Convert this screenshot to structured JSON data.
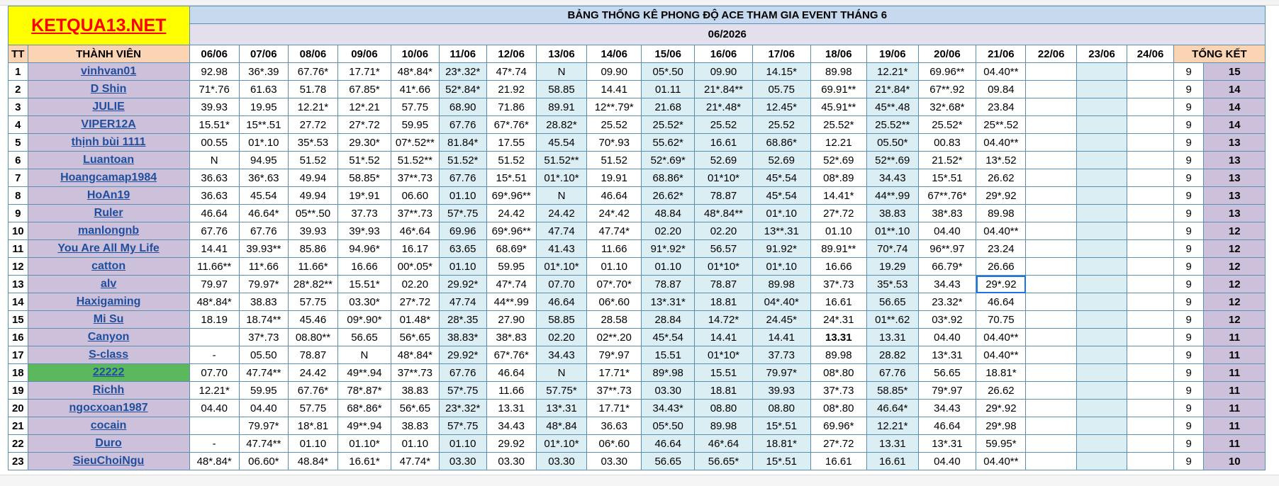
{
  "logo": "KETQUA13.NET",
  "title": "BẢNG THỐNG KÊ PHONG ĐỘ ACE THAM GIA EVENT THÁNG 6",
  "month": "06/2026",
  "headers": {
    "tt": "TT",
    "member": "THÀNH VIÊN",
    "summary": "TỔNG KẾT",
    "dates": [
      "06/06",
      "07/06",
      "08/06",
      "09/06",
      "10/06",
      "11/06",
      "12/06",
      "13/06",
      "14/06",
      "15/06",
      "16/06",
      "17/06",
      "18/06",
      "19/06",
      "20/06",
      "21/06",
      "22/06",
      "23/06",
      "24/06"
    ]
  },
  "colors": {
    "red": "#ff0000",
    "link": "#1f4e9e",
    "header_blue": "#2e75b6",
    "orange": "#ed7d31"
  },
  "rows": [
    {
      "no": "1",
      "name": "vinhvan01",
      "vals": [
        "92.98",
        "36*.39",
        "67.76*",
        "17.71*",
        "48*.84*",
        "23*.32*",
        "47*.74",
        "N",
        "09.90",
        "05*.50",
        "09.90",
        "14.15*",
        "89.98",
        "12.21*",
        "69.96**",
        "04.40**"
      ],
      "cnt": "9",
      "total": "15"
    },
    {
      "no": "2",
      "name": "D Shin",
      "vals": [
        "71*.76",
        "61.63",
        "51.78",
        "67.85*",
        "41*.66",
        "52*.84*",
        "21.92",
        "58.85",
        "14.41",
        "01.11",
        "21*.84**",
        "05.75",
        "69.91**",
        "21*.84*",
        "67**.92",
        "09.84"
      ],
      "cnt": "9",
      "total": "14"
    },
    {
      "no": "3",
      "name": "JULIE",
      "vals": [
        "39.93",
        "19.95",
        "12.21*",
        "12*.21",
        "57.75",
        "68.90",
        "71.86",
        "89.91",
        "12**.79*",
        "21.68",
        "21*.48*",
        "12.45*",
        "45.91**",
        "45**.48",
        "32*.68*",
        "23.84"
      ],
      "cnt": "9",
      "total": "14"
    },
    {
      "no": "4",
      "name": "VIPER12A",
      "vals": [
        "15.51*",
        "15**.51",
        "27.72",
        "27*.72",
        "59.95",
        "67.76",
        "67*.76*",
        "28.82*",
        "25.52",
        "25.52*",
        "25.52",
        "25.52",
        "25.52*",
        "25.52**",
        "25.52*",
        "25**.52"
      ],
      "cnt": "9",
      "total": "14"
    },
    {
      "no": "5",
      "name": "thịnh bùi 1111",
      "vals": [
        "00.55",
        "01*.10",
        "35*.53",
        "29.30*",
        "07*.52**",
        "81.84*",
        "17.55",
        "45.54",
        "70*.93",
        "55.62*",
        "16.61",
        "68.86*",
        "12.21",
        "05.50*",
        "00.83",
        "04.40**"
      ],
      "cnt": "9",
      "total": "13"
    },
    {
      "no": "6",
      "name": "Luantoan",
      "vals": [
        "N",
        "94.95",
        "51.52",
        "51*.52",
        "51.52**",
        "51.52*",
        "51.52",
        "51.52**",
        "51.52",
        "52*.69*",
        "52.69",
        "52.69",
        "52*.69",
        "52**.69",
        "21.52*",
        "13*.52"
      ],
      "cnt": "9",
      "total": "13"
    },
    {
      "no": "7",
      "name": "Hoangcamap1984",
      "vals": [
        "36.63",
        "36*.63",
        "49.94",
        "58.85*",
        "37**.73",
        "67.76",
        "15*.51",
        "01*.10*",
        "19.91",
        "68.86*",
        "01*10*",
        "45*.54",
        "08*.89",
        "34.43",
        "15*.51",
        "26.62"
      ],
      "cnt": "9",
      "total": "13"
    },
    {
      "no": "8",
      "name": "HoAn19",
      "vals": [
        "36.63",
        "45.54",
        "49.94",
        "19*.91",
        "06.60",
        "01.10",
        "69*.96**",
        "N",
        "46.64",
        "26.62*",
        "78.87",
        "45*.54",
        "14.41*",
        "44**.99",
        "67**.76*",
        "29*.92"
      ],
      "cnt": "9",
      "total": "13"
    },
    {
      "no": "9",
      "name": "Ruler",
      "vals": [
        "46.64",
        "46.64*",
        "05**.50",
        "37.73",
        "37**.73",
        "57*.75",
        "24.42",
        "24.42",
        "24*.42",
        "48.84",
        "48*.84**",
        "01*.10",
        "27*.72",
        "38.83",
        "38*.83",
        "89.98"
      ],
      "cnt": "9",
      "total": "13"
    },
    {
      "no": "10",
      "name": "manlongnb",
      "vals": [
        "67.76",
        "67.76",
        "39.93",
        "39*.93",
        "46*.64",
        "69.96",
        "69*.96**",
        "47.74",
        "47.74*",
        "02.20",
        "02.20",
        "13**.31",
        "01.10",
        "01**.10",
        "04.40",
        "04.40**"
      ],
      "cnt": "9",
      "total": "12"
    },
    {
      "no": "11",
      "name": "You Are All My Life",
      "vals": [
        "14.41",
        "39.93**",
        "85.86",
        "94.96*",
        "16.17",
        "63.65",
        "68.69*",
        "41.43",
        "11.66",
        "91*.92*",
        "56.57",
        "91.92*",
        "89.91**",
        "70*.74",
        "96**.97",
        "23.24"
      ],
      "cnt": "9",
      "total": "12"
    },
    {
      "no": "12",
      "name": "catton",
      "vals": [
        "11.66**",
        "11*.66",
        "11.66*",
        "16.66",
        "00*.05*",
        "01.10",
        "59.95",
        "01*.10*",
        "01.10",
        "01.10",
        "01*10*",
        "01*.10",
        "16.66",
        "19.29",
        "66.79*",
        "26.66"
      ],
      "cnt": "9",
      "total": "12"
    },
    {
      "no": "13",
      "name": "alv",
      "vals": [
        "79.97",
        "79.97*",
        "28*.82**",
        "15.51*",
        "02.20",
        "29.92*",
        "47*.74",
        "07.70",
        "07*.70*",
        "78.87",
        "78.87",
        "89.98",
        "37*.73",
        "35*.53",
        "34.43",
        "29*.92"
      ],
      "cnt": "9",
      "total": "12"
    },
    {
      "no": "14",
      "name": "Haxigaming",
      "vals": [
        "48*.84*",
        "38.83",
        "57.75",
        "03.30*",
        "27*.72",
        "47.74",
        "44**.99",
        "46.64",
        "06*.60",
        "13*.31*",
        "18.81",
        "04*.40*",
        "16.61",
        "56.65",
        "23.32*",
        "46.64"
      ],
      "cnt": "9",
      "total": "12"
    },
    {
      "no": "15",
      "name": "Mi Su",
      "vals": [
        "18.19",
        "18.74**",
        "45.46",
        "09*.90*",
        "01.48*",
        "28*.35",
        "27.90",
        "58.85",
        "28.58",
        "28.84",
        "14.72*",
        "24.45*",
        "24*.31",
        "01**.62",
        "03*.92",
        "70.75"
      ],
      "cnt": "9",
      "total": "12"
    },
    {
      "no": "16",
      "name": "Canyon",
      "vals": [
        "",
        "37*.73",
        "08.80**",
        "56.65",
        "56*.65",
        "38.83*",
        "38*.83",
        "02.20",
        "02**.20",
        "45*.54",
        "14.41",
        "14.41",
        "13.31",
        "13.31",
        "04.40",
        "04.40**"
      ],
      "cnt": "9",
      "total": "11"
    },
    {
      "no": "17",
      "name": "S-class",
      "vals": [
        "-",
        "05.50",
        "78.87",
        "N",
        "48*.84*",
        "29.92*",
        "67*.76*",
        "34.43",
        "79*.97",
        "15.51",
        "01*10*",
        "37.73",
        "89.98",
        "28.82",
        "13*.31",
        "04.40**"
      ],
      "cnt": "9",
      "total": "11"
    },
    {
      "no": "18",
      "name": "22222",
      "vals": [
        "07.70",
        "47.74**",
        "24.42",
        "49**.94",
        "37**.73",
        "67.76",
        "46.64",
        "N",
        "17.71*",
        "89*.98",
        "15.51",
        "79.97*",
        "08*.80",
        "67.76",
        "56.65",
        "18.81*"
      ],
      "cnt": "9",
      "total": "11"
    },
    {
      "no": "19",
      "name": "Richh",
      "vals": [
        "12.21*",
        "59.95",
        "67.76*",
        "78*.87*",
        "38.83",
        "57*.75",
        "11.66",
        "57.75*",
        "37**.73",
        "03.30",
        "18.81",
        "39.93",
        "37*.73",
        "58.85*",
        "79*.97",
        "26.62"
      ],
      "cnt": "9",
      "total": "11"
    },
    {
      "no": "20",
      "name": "ngocxoan1987",
      "vals": [
        "04.40",
        "04.40",
        "57.75",
        "68*.86*",
        "56*.65",
        "23*.32*",
        "13.31",
        "13*.31",
        "17.71*",
        "34.43*",
        "08.80",
        "08.80",
        "08*.80",
        "46.64*",
        "34.43",
        "29*.92"
      ],
      "cnt": "9",
      "total": "11"
    },
    {
      "no": "21",
      "name": "cocain",
      "vals": [
        "",
        "79.97*",
        "18*.81",
        "49**.94",
        "38.83",
        "57*.75",
        "34.43",
        "48*.84",
        "36.63",
        "05*.50",
        "89.98",
        "15*.51",
        "69.96*",
        "12.21*",
        "46.64",
        "29*.98"
      ],
      "cnt": "9",
      "total": "11"
    },
    {
      "no": "22",
      "name": "Duro",
      "vals": [
        "-",
        "47.74**",
        "01.10",
        "01.10*",
        "01.10",
        "01.10",
        "29.92",
        "01*.10*",
        "06*.60",
        "46.64",
        "46*.64",
        "18.81*",
        "27*.72",
        "13.31",
        "13*.31",
        "59.95*"
      ],
      "cnt": "9",
      "total": "11"
    },
    {
      "no": "23",
      "name": "SieuChoiNgu",
      "vals": [
        "48*.84*",
        "06.60*",
        "48.84*",
        "16.61*",
        "47.74*",
        "03.30",
        "03.30",
        "03.30",
        "03.30",
        "56.65",
        "56.65*",
        "15*.51",
        "16.61",
        "16.61",
        "04.40",
        "04.40**"
      ],
      "cnt": "9",
      "total": "10"
    }
  ]
}
